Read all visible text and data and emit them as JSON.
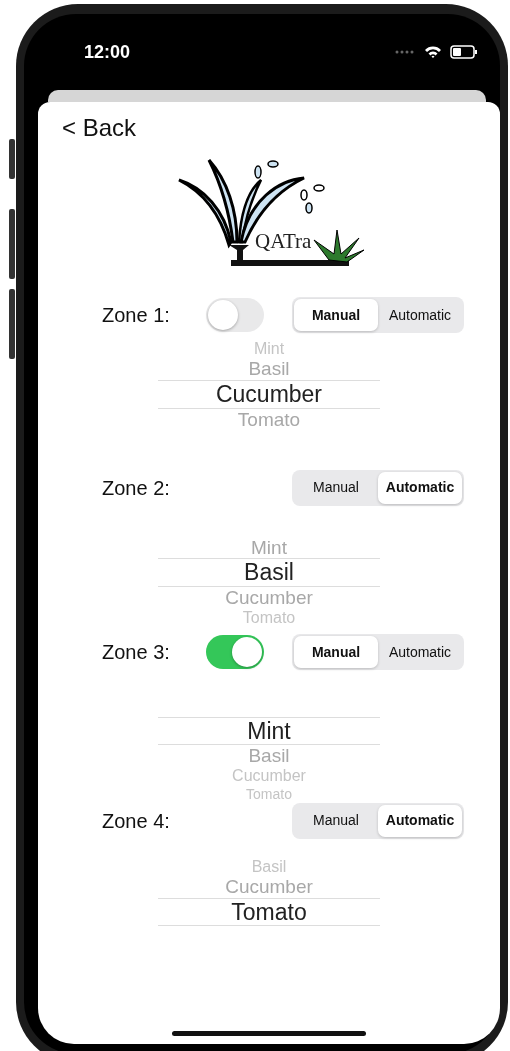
{
  "status_bar": {
    "time": "12:00"
  },
  "nav": {
    "back": "< Back"
  },
  "logo": {
    "text": "QATra"
  },
  "zones": [
    {
      "label": "Zone 1:",
      "switch": {
        "on": false
      },
      "modes": [
        {
          "label": "Manual",
          "selected": true
        },
        {
          "label": "Automatic",
          "selected": false
        }
      ],
      "picker": [
        {
          "label": "Mint",
          "selected": false
        },
        {
          "label": "Basil",
          "selected": false
        },
        {
          "label": "Cucumber",
          "selected": true
        },
        {
          "label": "Tomato",
          "selected": false
        }
      ]
    },
    {
      "label": "Zone 2:",
      "modes": [
        {
          "label": "Manual",
          "selected": false
        },
        {
          "label": "Automatic",
          "selected": true
        }
      ],
      "picker": [
        {
          "label": "Mint",
          "selected": false
        },
        {
          "label": "Basil",
          "selected": true
        },
        {
          "label": "Cucumber",
          "selected": false
        },
        {
          "label": "Tomato",
          "selected": false
        }
      ]
    },
    {
      "label": "Zone 3:",
      "switch": {
        "on": true
      },
      "modes": [
        {
          "label": "Manual",
          "selected": true
        },
        {
          "label": "Automatic",
          "selected": false
        }
      ],
      "picker": [
        {
          "label": "Mint",
          "selected": true
        },
        {
          "label": "Basil",
          "selected": false
        },
        {
          "label": "Cucumber",
          "selected": false
        },
        {
          "label": "Tomato",
          "selected": false
        }
      ]
    },
    {
      "label": "Zone 4:",
      "modes": [
        {
          "label": "Manual",
          "selected": false
        },
        {
          "label": "Automatic",
          "selected": true
        }
      ],
      "picker": [
        {
          "label": "Basil",
          "selected": false
        },
        {
          "label": "Cucumber",
          "selected": false
        },
        {
          "label": "Tomato",
          "selected": true
        }
      ]
    }
  ]
}
